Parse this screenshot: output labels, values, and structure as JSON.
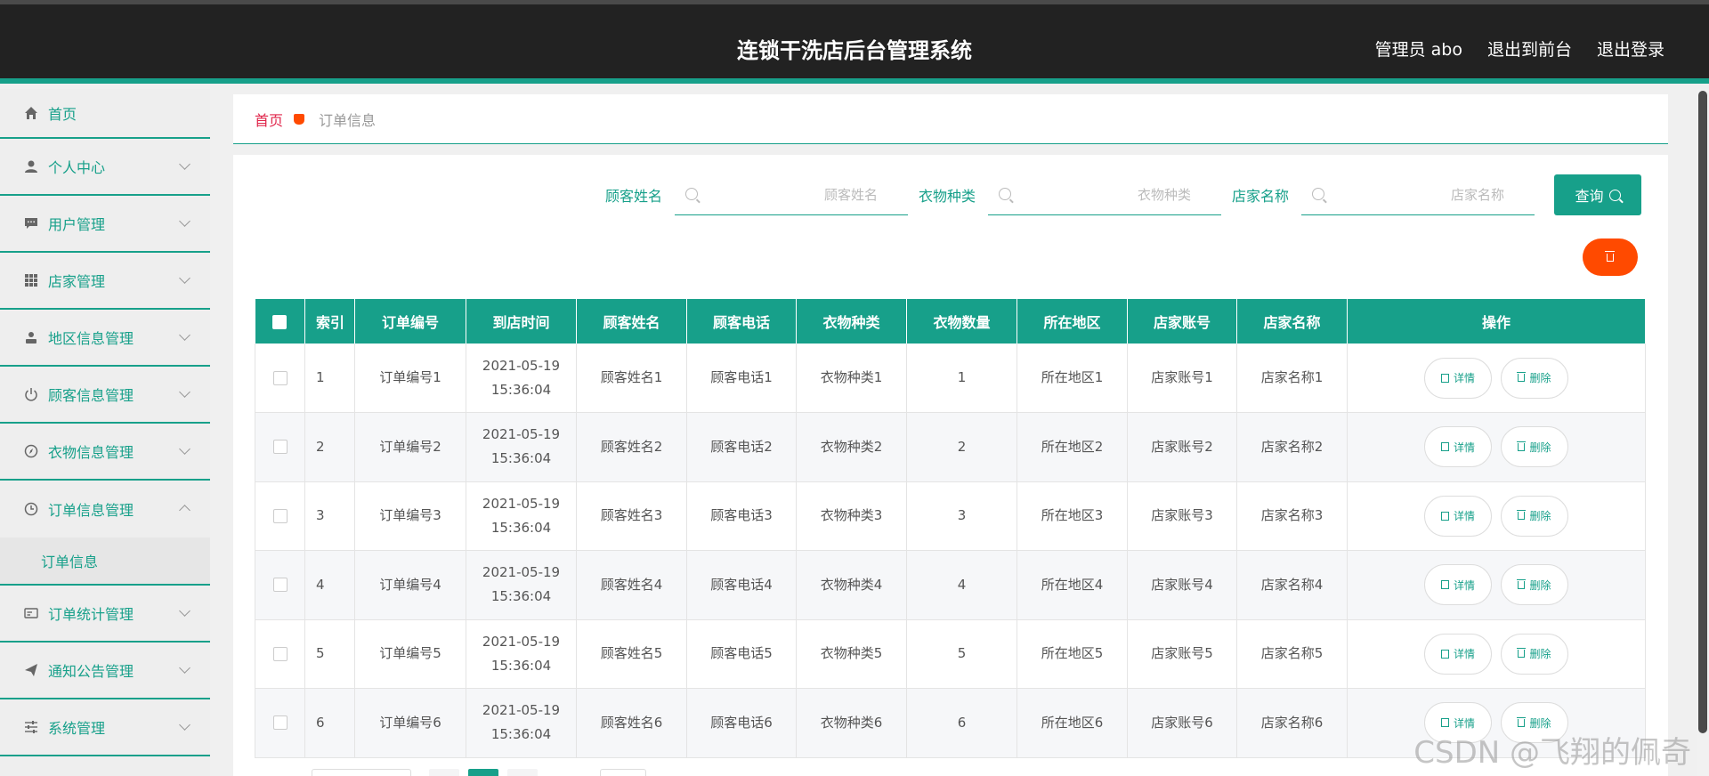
{
  "header": {
    "title": "连锁干洗店后台管理系统",
    "links": [
      "管理员 abo",
      "退出到前台",
      "退出登录"
    ]
  },
  "sidebar": {
    "items": [
      {
        "label": "首页",
        "icon": "home-icon"
      },
      {
        "label": "个人中心",
        "icon": "user-icon"
      },
      {
        "label": "用户管理",
        "icon": "chat-icon"
      },
      {
        "label": "店家管理",
        "icon": "grid-icon"
      },
      {
        "label": "地区信息管理",
        "icon": "user-pin-icon"
      },
      {
        "label": "顾客信息管理",
        "icon": "power-icon"
      },
      {
        "label": "衣物信息管理",
        "icon": "compass-icon"
      },
      {
        "label": "订单信息管理",
        "icon": "clock-icon",
        "expanded": true,
        "submenu": [
          "订单信息"
        ]
      },
      {
        "label": "订单统计管理",
        "icon": "card-icon"
      },
      {
        "label": "通知公告管理",
        "icon": "send-icon"
      },
      {
        "label": "系统管理",
        "icon": "sliders-icon"
      }
    ]
  },
  "breadcrumb": {
    "home": "首页",
    "current": "订单信息"
  },
  "search": {
    "fields": [
      {
        "label": "顾客姓名",
        "placeholder": "顾客姓名"
      },
      {
        "label": "衣物种类",
        "placeholder": "衣物种类"
      },
      {
        "label": "店家名称",
        "placeholder": "店家名称"
      }
    ],
    "button": "查询"
  },
  "table": {
    "headers": [
      "索引",
      "订单编号",
      "到店时间",
      "顾客姓名",
      "顾客电话",
      "衣物种类",
      "衣物数量",
      "所在地区",
      "店家账号",
      "店家名称",
      "操作"
    ],
    "rows": [
      [
        "1",
        "订单编号1",
        "2021-05-19 15:36:04",
        "顾客姓名1",
        "顾客电话1",
        "衣物种类1",
        "1",
        "所在地区1",
        "店家账号1",
        "店家名称1"
      ],
      [
        "2",
        "订单编号2",
        "2021-05-19 15:36:04",
        "顾客姓名2",
        "顾客电话2",
        "衣物种类2",
        "2",
        "所在地区2",
        "店家账号2",
        "店家名称2"
      ],
      [
        "3",
        "订单编号3",
        "2021-05-19 15:36:04",
        "顾客姓名3",
        "顾客电话3",
        "衣物种类3",
        "3",
        "所在地区3",
        "店家账号3",
        "店家名称3"
      ],
      [
        "4",
        "订单编号4",
        "2021-05-19 15:36:04",
        "顾客姓名4",
        "顾客电话4",
        "衣物种类4",
        "4",
        "所在地区4",
        "店家账号4",
        "店家名称4"
      ],
      [
        "5",
        "订单编号5",
        "2021-05-19 15:36:04",
        "顾客姓名5",
        "顾客电话5",
        "衣物种类5",
        "5",
        "所在地区5",
        "店家账号5",
        "店家名称5"
      ],
      [
        "6",
        "订单编号6",
        "2021-05-19 15:36:04",
        "顾客姓名6",
        "顾客电话6",
        "衣物种类6",
        "6",
        "所在地区6",
        "店家账号6",
        "店家名称6"
      ]
    ],
    "actions": {
      "detail": "详情",
      "delete": "删除"
    }
  },
  "watermark": "CSDN @飞翔的佩奇",
  "colors": {
    "accent": "#17a08a",
    "danger": "#ff4a00",
    "header_bg": "#222222"
  }
}
